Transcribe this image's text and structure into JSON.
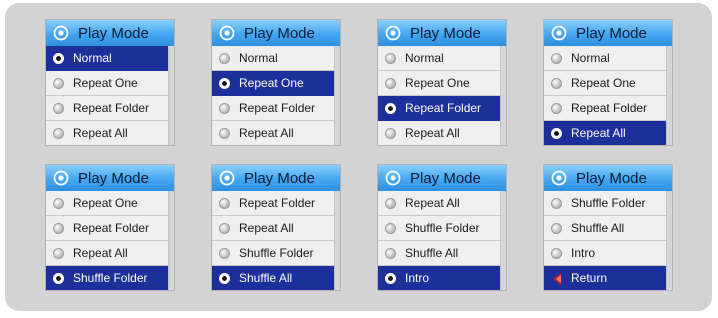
{
  "header_title": "Play Mode",
  "colors": {
    "header_blue": "#44a6f0",
    "selected_blue": "#1c2f9b",
    "panel_bg": "#f1f1f1",
    "stage_bg": "#d3d3d3"
  },
  "icons": {
    "header": "settings-target-icon",
    "option": "radio-icon",
    "return": "return-arrow-icon"
  },
  "panels": [
    {
      "items": [
        "Normal",
        "Repeat One",
        "Repeat Folder",
        "Repeat All"
      ],
      "selected_index": 0
    },
    {
      "items": [
        "Normal",
        "Repeat One",
        "Repeat Folder",
        "Repeat All"
      ],
      "selected_index": 1
    },
    {
      "items": [
        "Normal",
        "Repeat One",
        "Repeat Folder",
        "Repeat All"
      ],
      "selected_index": 2
    },
    {
      "items": [
        "Normal",
        "Repeat One",
        "Repeat Folder",
        "Repeat All"
      ],
      "selected_index": 3
    },
    {
      "items": [
        "Repeat One",
        "Repeat Folder",
        "Repeat All",
        "Shuffle Folder"
      ],
      "selected_index": 3
    },
    {
      "items": [
        "Repeat Folder",
        "Repeat All",
        "Shuffle Folder",
        "Shuffle All"
      ],
      "selected_index": 3
    },
    {
      "items": [
        "Repeat All",
        "Shuffle Folder",
        "Shuffle All",
        "Intro"
      ],
      "selected_index": 3
    },
    {
      "items": [
        "Shuffle Folder",
        "Shuffle All",
        "Intro",
        "Return"
      ],
      "selected_index": 3,
      "return_item_index": 3
    }
  ]
}
